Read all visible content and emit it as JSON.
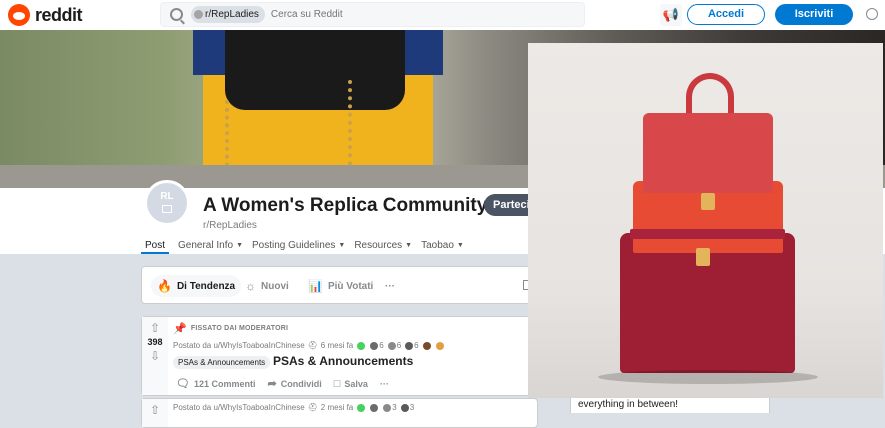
{
  "header": {
    "logo_text": "reddit",
    "search_chip": "r/RepLadies",
    "search_placeholder": "Cerca su Reddit",
    "login_label": "Accedi",
    "signup_label": "Iscriviti"
  },
  "community": {
    "avatar_initials": "RL",
    "title": "A Women's Replica Community",
    "subreddit": "r/RepLadies",
    "join_label": "Partecipa",
    "tabs": [
      {
        "label": "Post",
        "active": true
      },
      {
        "label": "General Info",
        "dropdown": true
      },
      {
        "label": "Posting Guidelines",
        "dropdown": true
      },
      {
        "label": "Resources",
        "dropdown": true
      },
      {
        "label": "Taobao",
        "dropdown": true
      }
    ]
  },
  "sort": {
    "items": [
      {
        "label": "Di Tendenza",
        "icon": "flame-icon",
        "active": true
      },
      {
        "label": "Nuovi",
        "icon": "sun-icon"
      },
      {
        "label": "Più Votati",
        "icon": "chart-icon"
      }
    ],
    "more": "···"
  },
  "posts": [
    {
      "score": "398",
      "pinned_label": "FISSATO DAI MODERATORI",
      "posted_by": "Postato da u/WhyIsToaboaInChinese",
      "time": "6 mesi fa",
      "awards": [
        "6",
        "6",
        "6"
      ],
      "flair": "PSAs & Announcements",
      "title": "PSAs & Announcements",
      "comments": "121 Commenti",
      "share": "Condividi",
      "save": "Salva",
      "more": "···"
    },
    {
      "posted_by": "Postato da u/WhyIsToaboaInChinese",
      "time": "2 mesi fa",
      "awards": [
        "3",
        "3"
      ]
    }
  ],
  "sidebar": {
    "snippet": "everything in between!"
  },
  "colors": {
    "accent": "#0079d3",
    "brand": "#ff4500",
    "pinned": "#46d160"
  }
}
